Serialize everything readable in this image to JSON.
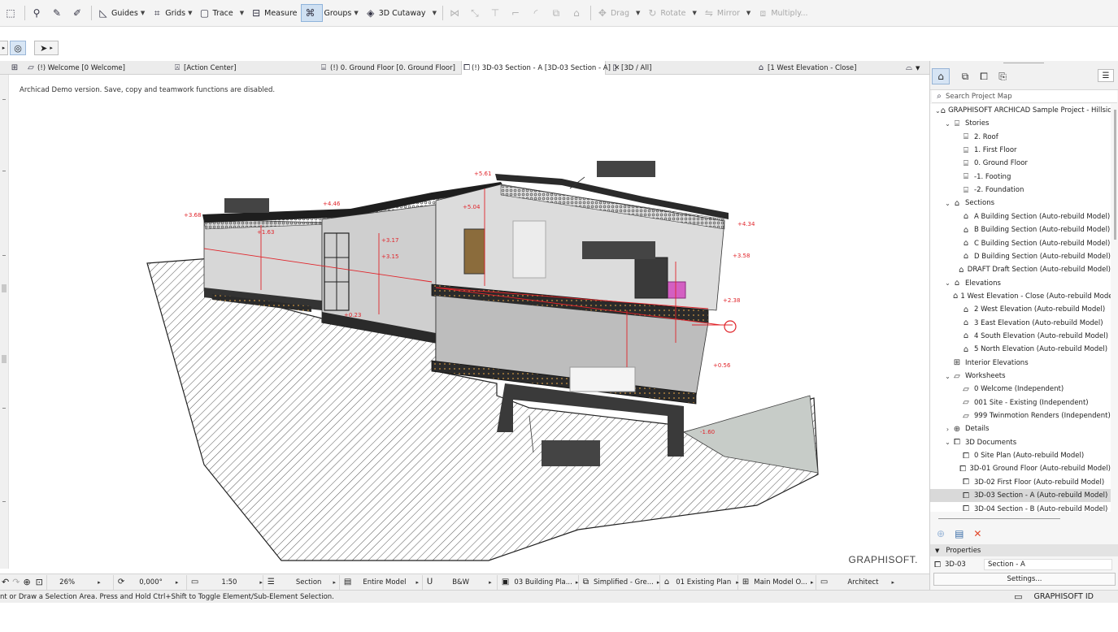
{
  "toolbar": {
    "items": [
      {
        "label": "Guides",
        "icon": "guides-icon",
        "has_menu": true
      },
      {
        "label": "Grids",
        "icon": "grids-icon",
        "has_menu": true
      },
      {
        "label": "Trace",
        "icon": "trace-icon",
        "has_menu": true
      },
      {
        "label": "Measure",
        "icon": "measure-icon",
        "has_menu": false
      },
      {
        "label": "Groups",
        "icon": "groups-icon",
        "has_menu": true
      },
      {
        "label": "3D Cutaway",
        "icon": "cutaway-icon",
        "has_menu": true
      }
    ],
    "disabled_items": [
      {
        "label": "Drag",
        "icon": "drag-icon"
      },
      {
        "label": "Rotate",
        "icon": "rotate-icon"
      },
      {
        "label": "Mirror",
        "icon": "mirror-icon"
      },
      {
        "label": "Multiply...",
        "icon": "multiply-icon"
      }
    ]
  },
  "tabs": [
    {
      "label": "(!) Welcome [0 Welcome]",
      "icon": "worksheet-icon"
    },
    {
      "label": "[Action Center]",
      "icon": "action-center-icon"
    },
    {
      "label": "(!) 0. Ground Floor [0. Ground Floor]",
      "icon": "floor-plan-icon"
    },
    {
      "label": "(!) 3D-03 Section - A [3D-03 Section - A]",
      "icon": "3d-document-icon",
      "active": true
    },
    {
      "label": "[3D / All]",
      "icon": "3d-view-icon"
    },
    {
      "label": "[1 West Elevation - Close]",
      "icon": "elevation-icon"
    }
  ],
  "viewport": {
    "demo_notice": "Archicad Demo version. Save, copy and teamwork functions are disabled.",
    "brand": "GRAPHISOFT.",
    "elevation_labels": [
      "+5.61",
      "+4.46",
      "+3.68",
      "+4.34",
      "+3.58",
      "+2.38",
      "+0.56",
      "+5.04",
      "+3.17",
      "+3.15",
      "+1.63",
      "+0.23",
      "-1.60"
    ]
  },
  "statusbar": {
    "zoom": "26%",
    "angle": "0,000°",
    "scale": "1:50",
    "view_type": "Section",
    "model_filter": "Entire Model",
    "pen_set": "B&W",
    "layer_combo": "03 Building Pla...",
    "model_view": "Simplified - Gre...",
    "renovation": "01 Existing Plan",
    "dimension": "Main Model O...",
    "user": "Architect"
  },
  "hint": "nt or Draw a Selection Area. Press and Hold Ctrl+Shift to Toggle Element/Sub-Element Selection.",
  "graphisoft_id": "GRAPHISOFT ID",
  "navigator": {
    "search_placeholder": "Search Project Map",
    "tree": [
      {
        "level": 0,
        "chev": "v",
        "icon": "project-icon",
        "label": "GRAPHISOFT ARCHICAD Sample Project - Hillside"
      },
      {
        "level": 1,
        "chev": "v",
        "icon": "stories-icon",
        "label": "Stories"
      },
      {
        "level": 2,
        "chev": "",
        "icon": "story-icon",
        "label": "2. Roof"
      },
      {
        "level": 2,
        "chev": "",
        "icon": "story-icon",
        "label": "1. First Floor"
      },
      {
        "level": 2,
        "chev": "",
        "icon": "story-icon",
        "label": "0. Ground Floor"
      },
      {
        "level": 2,
        "chev": "",
        "icon": "story-icon",
        "label": "-1. Footing"
      },
      {
        "level": 2,
        "chev": "",
        "icon": "story-icon",
        "label": "-2. Foundation"
      },
      {
        "level": 1,
        "chev": "v",
        "icon": "sections-icon",
        "label": "Sections"
      },
      {
        "level": 2,
        "chev": "",
        "icon": "section-icon",
        "label": "A Building Section (Auto-rebuild Model)"
      },
      {
        "level": 2,
        "chev": "",
        "icon": "section-icon",
        "label": "B Building Section (Auto-rebuild Model)"
      },
      {
        "level": 2,
        "chev": "",
        "icon": "section-icon",
        "label": "C Building Section (Auto-rebuild Model)"
      },
      {
        "level": 2,
        "chev": "",
        "icon": "section-icon",
        "label": "D Building Section (Auto-rebuild Model)"
      },
      {
        "level": 2,
        "chev": "",
        "icon": "section-icon",
        "label": "DRAFT Draft Section (Auto-rebuild Model)"
      },
      {
        "level": 1,
        "chev": "v",
        "icon": "elevations-icon",
        "label": "Elevations"
      },
      {
        "level": 2,
        "chev": "",
        "icon": "elevation-icon",
        "label": "1 West Elevation - Close (Auto-rebuild Model)"
      },
      {
        "level": 2,
        "chev": "",
        "icon": "elevation-icon",
        "label": "2 West Elevation (Auto-rebuild Model)"
      },
      {
        "level": 2,
        "chev": "",
        "icon": "elevation-icon",
        "label": "3 East Elevation (Auto-rebuild Model)"
      },
      {
        "level": 2,
        "chev": "",
        "icon": "elevation-icon",
        "label": "4 South Elevation (Auto-rebuild Model)"
      },
      {
        "level": 2,
        "chev": "",
        "icon": "elevation-icon",
        "label": "5 North Elevation (Auto-rebuild Model)"
      },
      {
        "level": 1,
        "chev": "",
        "icon": "interior-elevation-icon",
        "label": "Interior Elevations"
      },
      {
        "level": 1,
        "chev": "v",
        "icon": "worksheets-icon",
        "label": "Worksheets"
      },
      {
        "level": 2,
        "chev": "",
        "icon": "worksheet-icon",
        "label": "0 Welcome (Independent)"
      },
      {
        "level": 2,
        "chev": "",
        "icon": "worksheet-icon",
        "label": "001 Site - Existing (Independent)"
      },
      {
        "level": 2,
        "chev": "",
        "icon": "worksheet-icon",
        "label": "999 Twinmotion Renders (Independent)"
      },
      {
        "level": 1,
        "chev": ">",
        "icon": "details-icon",
        "label": "Details"
      },
      {
        "level": 1,
        "chev": "v",
        "icon": "3d-documents-icon",
        "label": "3D Documents"
      },
      {
        "level": 2,
        "chev": "",
        "icon": "3d-document-icon",
        "label": "0 Site Plan (Auto-rebuild Model)"
      },
      {
        "level": 2,
        "chev": "",
        "icon": "3d-document-icon",
        "label": "3D-01 Ground Floor (Auto-rebuild Model)"
      },
      {
        "level": 2,
        "chev": "",
        "icon": "3d-document-icon",
        "label": "3D-02 First Floor (Auto-rebuild Model)"
      },
      {
        "level": 2,
        "chev": "",
        "icon": "3d-document-icon",
        "label": "3D-03 Section - A (Auto-rebuild Model)",
        "selected": true
      },
      {
        "level": 2,
        "chev": "",
        "icon": "3d-document-icon",
        "label": "3D-04 Section - B (Auto-rebuild Model)"
      }
    ],
    "properties": {
      "header": "Properties",
      "id": "3D-03",
      "name": "Section - A",
      "settings_label": "Settings..."
    }
  },
  "colors": {
    "dimension_red": "#e0242a",
    "tab_active": "#ffffff",
    "selection_grey": "#d9d9d9",
    "delete_red": "#e2482b"
  }
}
